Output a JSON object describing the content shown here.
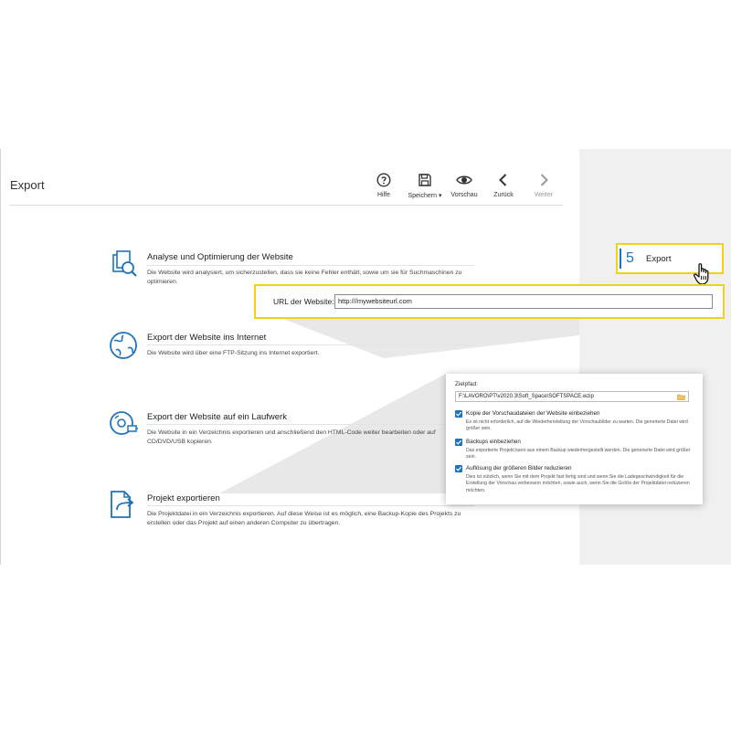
{
  "window": {
    "title": "Export"
  },
  "toolbar": {
    "help_label": "Hilfe",
    "save_label": "Speichern",
    "preview_label": "Vorschau",
    "back_label": "Zurück",
    "next_label": "Weiter"
  },
  "sections": [
    {
      "icon": "analyze-icon",
      "title": "Analyse und Optimierung der Website",
      "desc": "Die Website wird analysiert, um sicherzustellen, dass sie keine Fehler enthält, sowie um sie für Suchmaschinen zu optimieren."
    },
    {
      "icon": "globe-icon",
      "title": "Export der Website ins Internet",
      "desc": "Die Website wird über eine FTP-Sitzung ins Internet exportiert."
    },
    {
      "icon": "disc-usb-icon",
      "title": "Export der Website auf ein Laufwerk",
      "desc": "Die Website in ein Verzeichnis exportieren und  anschließend den HTML-Code weiter bearbeiten oder auf CD/DVD/USB kopieren."
    },
    {
      "icon": "file-export-icon",
      "title": "Projekt exportieren",
      "desc": "Die Projektdatei in ein Verzeichnis exportieren. Auf diese Weise ist es möglich, eine Backup-Kopie des Projekts zu erstellen oder das Projekt auf einen anderen Computer zu übertragen."
    }
  ],
  "step": {
    "number": "5",
    "label": "Export"
  },
  "url": {
    "label": "URL der Website:",
    "value": "http:///mywebsiteurl.com"
  },
  "export_options": {
    "path_label": "Zielpfad:",
    "path_value": "F:\\LAVORO\\PT\\v2020.3\\Soft_Space\\SOFTSPACE.wzip",
    "options": [
      {
        "checked": true,
        "label": "Kopie der Vorschaudateien der Website einbeziehen",
        "desc": "Es ist nicht erforderlich, auf die Wiederherstellung der Vorschaubilder zu warten. Die generierte Datei wird größer sein."
      },
      {
        "checked": true,
        "label": "Backups einbeziehen",
        "desc": "Das exportierte Projekt kann aus einem Backup wiederhergestellt werden. Die generierte Datei wird größer sein."
      },
      {
        "checked": true,
        "label": "Auflösung der größeren Bilder reduzieren",
        "desc": "Dies ist nützlich, wenn Sie mit dem Projekt fast fertig sind und wenn Sie die Ladegeschwindigkeit für die Erstellung der Vorschau verbessern möchten, sowie auch, wenn Sie die Größe der Projektdatei reduzieren möchten."
      }
    ]
  },
  "colors": {
    "accent": "#1e73be",
    "highlight": "#f0d21b",
    "panel": "#f0f0f0"
  }
}
